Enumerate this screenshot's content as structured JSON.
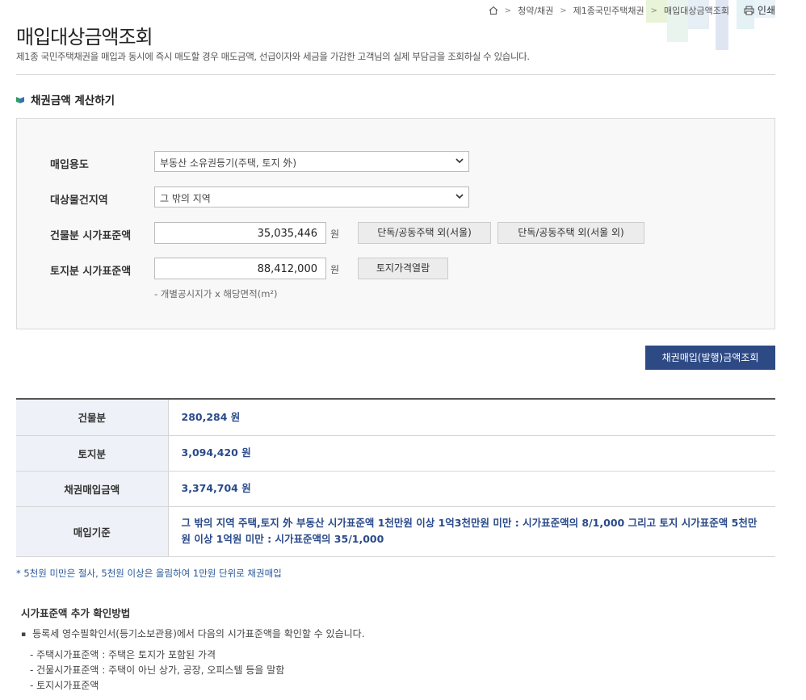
{
  "breadcrumb": {
    "items": [
      "청약/채권",
      "제1종국민주택채권",
      "매입대상금액조회"
    ],
    "print_label": "인쇄"
  },
  "header": {
    "title": "매입대상금액조회",
    "description": "제1종 국민주택채권을 매입과 동시에 즉시 매도할 경우 매도금액, 선급이자와 세금을 가감한 고객님의 실제 부담금을 조회하실 수 있습니다."
  },
  "section": {
    "title": "채권금액 계산하기"
  },
  "form": {
    "purpose_label": "매입용도",
    "purpose_value": "부동산 소유권등기(주택, 토지 外)",
    "region_label": "대상물건지역",
    "region_value": "그 밖의 지역",
    "building_label": "건물분 시가표준액",
    "building_value": "35,035,446",
    "land_label": "토지분 시가표준액",
    "land_value": "88,412,000",
    "unit": "원",
    "btn_house_seoul": "단독/공동주택 외(서울)",
    "btn_house_other": "단독/공동주택 외(서울 외)",
    "btn_land_price": "토지가격열람",
    "hint": "- 개별공시지가 x 해당면적(m²)"
  },
  "query_button": "채권매입(발행)금액조회",
  "result": {
    "rows": [
      {
        "label": "건물분",
        "value": "280,284 원"
      },
      {
        "label": "토지분",
        "value": "3,094,420 원"
      },
      {
        "label": "채권매입금액",
        "value": "3,374,704 원"
      },
      {
        "label": "매입기준",
        "value": "그 밖의 지역 주택,토지 外 부동산 시가표준액 1천만원 이상 1억3천만원 미만 : 시가표준액의 8/1,000 그리고 토지 시가표준액 5천만원 이상 1억원 미만 : 시가표준액의 35/1,000"
      }
    ]
  },
  "note": "* 5천원 미만은 절사, 5천원 이상은 올림하여 1만원 단위로 채권매입",
  "info": {
    "title": "시가표준액 추가 확인방법",
    "bullet": "등록세 영수필확인서(등기소보관용)에서 다음의 시가표준액을 확인할 수 있습니다.",
    "items": [
      "- 주택시가표준액 : 주택은 토지가 포함된 가격",
      "- 건물시가표준액 : 주택이 아닌 상가, 공장, 오피스텔 등을 말함",
      "- 토지시가표준액"
    ]
  },
  "colors": {
    "primary": "#2e4a85",
    "value_text": "#2a4a8a",
    "header_cell": "#eef1f7"
  }
}
